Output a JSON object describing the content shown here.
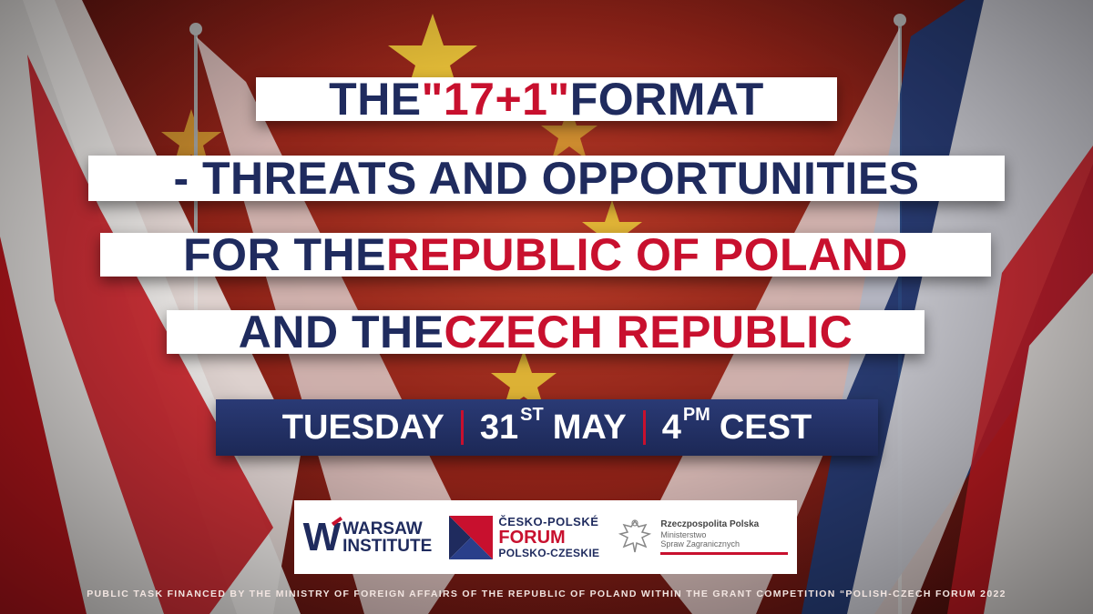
{
  "title": {
    "line1": {
      "a": "THE ",
      "b": "\"17+1\"",
      "c": " FORMAT"
    },
    "line2": "- THREATS AND OPPORTUNITIES",
    "line3": {
      "a": "FOR THE ",
      "b": "REPUBLIC OF POLAND"
    },
    "line4": {
      "a": "AND THE ",
      "b": "CZECH REPUBLIC"
    }
  },
  "event": {
    "day": "TUESDAY",
    "date_num": "31",
    "date_sup": "ST",
    "month": "MAY",
    "time_num": "4",
    "time_sup": "PM",
    "tz": "CEST"
  },
  "logos": {
    "warsaw_institute": {
      "w": "W",
      "line1": "WARSAW",
      "line2": "INSTITUTE"
    },
    "forum": {
      "line1": "ČESKO-POLSKÉ",
      "line2": "FORUM",
      "line3": "POLSKO-CZESKIE"
    },
    "mfa": {
      "line1": "Rzeczpospolita Polska",
      "line2": "Ministerstwo",
      "line3": "Spraw Zagranicznych"
    }
  },
  "footer": "PUBLIC TASK FINANCED BY THE MINISTRY OF FOREIGN AFFAIRS OF THE REPUBLIC OF POLAND WITHIN THE GRANT COMPETITION “POLISH-CZECH FORUM 2022",
  "colors": {
    "navy": "#1f2b5e",
    "red": "#c8102e",
    "white": "#ffffff"
  }
}
